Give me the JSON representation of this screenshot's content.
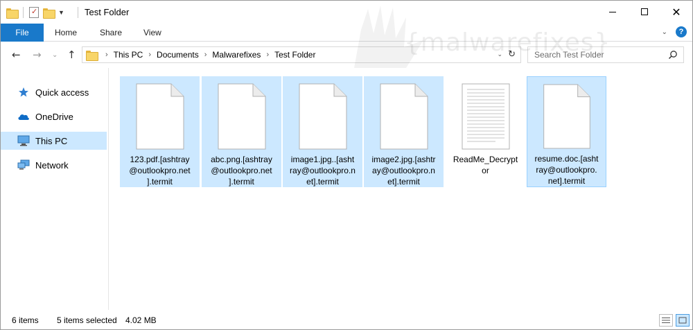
{
  "window": {
    "title": "Test Folder"
  },
  "ribbon": {
    "file_tab": "File",
    "tabs": [
      "Home",
      "Share",
      "View"
    ]
  },
  "address": {
    "crumbs": [
      "This PC",
      "Documents",
      "Malwarefixes",
      "Test Folder"
    ]
  },
  "search": {
    "placeholder": "Search Test Folder"
  },
  "watermark": "{malwarefixes}",
  "sidebar": {
    "items": [
      {
        "label": "Quick access",
        "icon": "star-icon",
        "selected": false
      },
      {
        "label": "OneDrive",
        "icon": "cloud-icon",
        "selected": false
      },
      {
        "label": "This PC",
        "icon": "computer-icon",
        "selected": true
      },
      {
        "label": "Network",
        "icon": "network-icon",
        "selected": false
      }
    ]
  },
  "files": [
    {
      "name": "123.pdf.[ashtray@outlookpro.net].termit",
      "lines": [
        "123.pdf.[ashtray",
        "@outlookpro.net",
        "].termit"
      ],
      "selected": true,
      "icon": "blank-document-icon"
    },
    {
      "name": "abc.png.[ashtray@outlookpro.net].termit",
      "lines": [
        "abc.png.[ashtray",
        "@outlookpro.net",
        "].termit"
      ],
      "selected": true,
      "icon": "blank-document-icon"
    },
    {
      "name": "image1.jpg..[ashtray@outlookpro.net].termit",
      "lines": [
        "image1.jpg..[asht",
        "ray@outlookpro.n",
        "et].termit"
      ],
      "selected": true,
      "icon": "blank-document-icon"
    },
    {
      "name": "image2.jpg.[ashtray@outlookpro.net].termit",
      "lines": [
        "image2.jpg.[ashtr",
        "ay@outlookpro.n",
        "et].termit"
      ],
      "selected": true,
      "icon": "blank-document-icon"
    },
    {
      "name": "ReadMe_Decryptor",
      "lines": [
        "ReadMe_Decrypt",
        "or"
      ],
      "selected": false,
      "icon": "text-document-icon"
    },
    {
      "name": "resume.doc.[ashtray@outlookpro.net].termit",
      "lines": [
        "resume.doc.[asht",
        "ray@outlookpro.",
        "net].termit"
      ],
      "selected": true,
      "icon": "blank-document-icon"
    }
  ],
  "status": {
    "item_count": "6 items",
    "selection": "5 items selected",
    "size": "4.02 MB"
  },
  "colors": {
    "accent": "#1979ca",
    "selection": "#cce8ff",
    "selection_border": "#99d1ff"
  }
}
